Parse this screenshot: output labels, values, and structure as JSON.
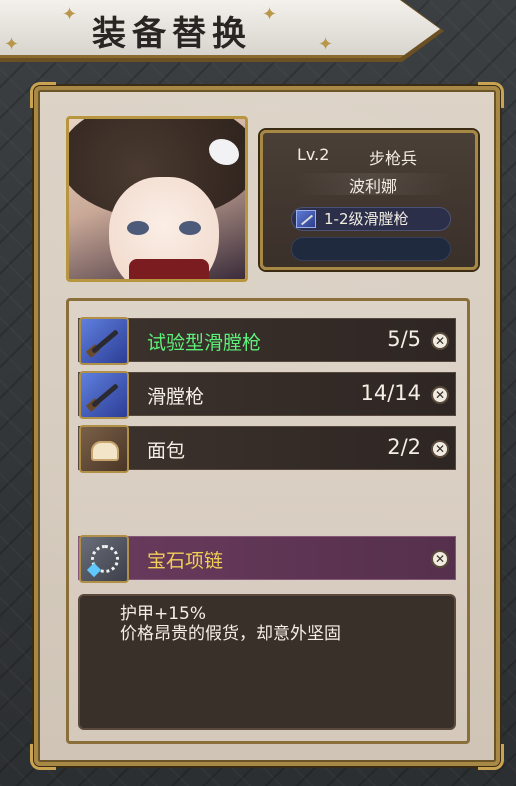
{
  "window": {
    "title": "装备替换"
  },
  "character": {
    "level": "Lv.2",
    "class": "步枪兵",
    "name": "波利娜",
    "weapon": "1-2级滑膛枪"
  },
  "items": [
    {
      "name": "试验型滑膛枪",
      "count": "5/5",
      "icon": "musket-icon",
      "color": "#5df07a"
    },
    {
      "name": "滑膛枪",
      "count": "14/14",
      "icon": "musket-icon",
      "color": "#f4efe6"
    },
    {
      "name": "面包",
      "count": "2/2",
      "icon": "bread-icon",
      "color": "#f4efe6"
    }
  ],
  "accessory": {
    "name": "宝石项链",
    "icon": "necklace-icon",
    "color": "#f2cf57"
  },
  "description": {
    "stat": "护甲+15%",
    "flavor": "价格昂贵的假货，却意外坚固"
  },
  "remove_glyph": "✕"
}
